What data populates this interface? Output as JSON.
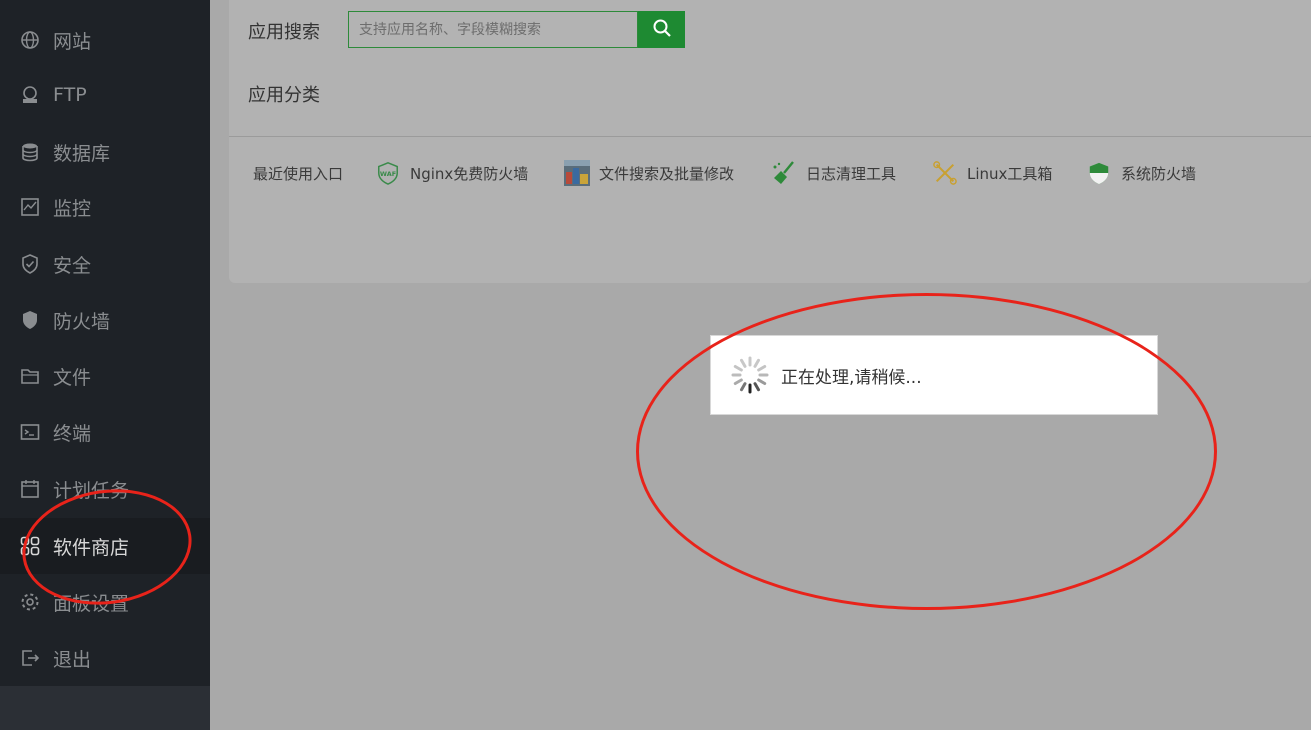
{
  "sidebar": {
    "items": [
      {
        "label": "网站",
        "icon": "globe-icon"
      },
      {
        "label": "FTP",
        "icon": "ftp-icon"
      },
      {
        "label": "数据库",
        "icon": "database-icon"
      },
      {
        "label": "监控",
        "icon": "monitor-icon"
      },
      {
        "label": "安全",
        "icon": "shield-check-icon"
      },
      {
        "label": "防火墙",
        "icon": "firewall-icon"
      },
      {
        "label": "文件",
        "icon": "folder-icon"
      },
      {
        "label": "终端",
        "icon": "terminal-icon"
      },
      {
        "label": "计划任务",
        "icon": "calendar-icon"
      },
      {
        "label": "软件商店",
        "icon": "apps-grid-icon",
        "active": true
      },
      {
        "label": "面板设置",
        "icon": "gear-icon"
      },
      {
        "label": "退出",
        "icon": "logout-icon"
      }
    ]
  },
  "main": {
    "search_label": "应用搜索",
    "search_placeholder": "支持应用名称、字段模糊搜索",
    "category_label": "应用分类",
    "recent_label": "最近使用入口",
    "recent_apps": [
      {
        "label": "Nginx免费防火墙",
        "icon": "waf-icon"
      },
      {
        "label": "文件搜索及批量修改",
        "icon": "file-search-thumbnail-icon"
      },
      {
        "label": "日志清理工具",
        "icon": "broom-icon"
      },
      {
        "label": "Linux工具箱",
        "icon": "tools-icon"
      },
      {
        "label": "系统防火墙",
        "icon": "shield-icon"
      }
    ]
  },
  "loading": {
    "text": "正在处理,请稍候..."
  },
  "colors": {
    "accent_green": "#1e8a32",
    "annotation_red": "#e8231a"
  }
}
